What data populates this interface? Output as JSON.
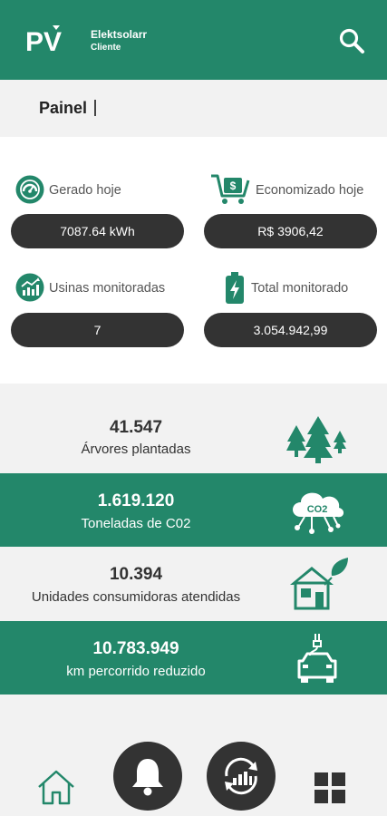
{
  "header": {
    "logo_text": "PV",
    "brand_name": "Elektsolarr",
    "brand_subtitle": "Cliente",
    "search_icon": "search-icon",
    "bg_color": "#23876a"
  },
  "painel": {
    "title": "Painel"
  },
  "stats": {
    "generated_today": {
      "label": "Gerado hoje",
      "value": "7087.64 kWh",
      "icon": "gauge-icon"
    },
    "saved_today": {
      "label": "Economizado hoje",
      "value": "R$ 3906,42",
      "icon": "shopping-cart-money-icon"
    },
    "plants_monitored": {
      "label": "Usinas monitoradas",
      "value": "7",
      "icon": "chart-growth-icon"
    },
    "total_monitored": {
      "label": "Total monitorado",
      "value": "3.054.942,99",
      "icon": "battery-charge-icon"
    }
  },
  "impact": [
    {
      "value": "41.547",
      "label": "Árvores plantadas",
      "icon": "trees-icon",
      "style": "light"
    },
    {
      "value": "1.619.120",
      "label": "Toneladas de C02",
      "icon": "co2-cloud-icon",
      "icon_text": "CO2",
      "style": "green"
    },
    {
      "value": "10.394",
      "label": "Unidades consumidoras atendidas",
      "icon": "eco-house-icon",
      "style": "light"
    },
    {
      "value": "10.783.949",
      "label": "km percorrido reduzido",
      "icon": "electric-car-icon",
      "style": "green"
    }
  ],
  "bottom_nav": {
    "home": "home-icon",
    "notifications": "bell-icon",
    "monitoring": "monitoring-refresh-icon",
    "menu": "grid-menu-icon"
  },
  "colors": {
    "primary": "#23876a",
    "dark": "#333333",
    "background": "#f2f2f2"
  }
}
